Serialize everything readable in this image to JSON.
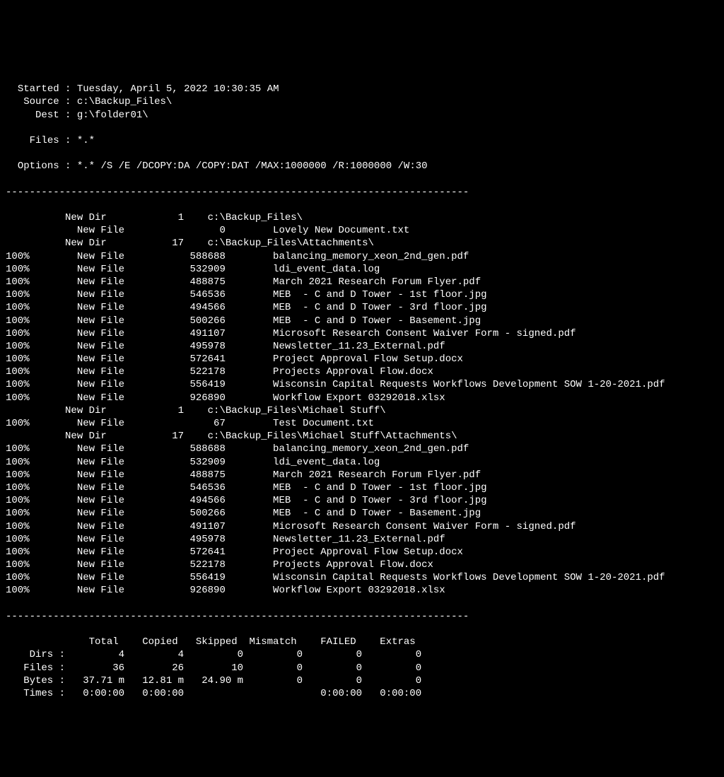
{
  "header": {
    "started_label": "Started",
    "started_value": "Tuesday, April 5, 2022 10:30:35 AM",
    "source_label": "Source",
    "source_value": "c:\\Backup_Files\\",
    "dest_label": "Dest",
    "dest_value": "g:\\folder01\\",
    "files_label": "Files",
    "files_value": "*.*",
    "options_label": "Options",
    "options_value": "*.* /S /E /DCOPY:DA /COPY:DAT /MAX:1000000 /R:1000000 /W:30"
  },
  "separator": "------------------------------------------------------------------------------",
  "rows": [
    {
      "pct": "",
      "status": "New Dir",
      "count": "1",
      "size": "",
      "path": "c:\\Backup_Files\\"
    },
    {
      "pct": "",
      "status": "New File",
      "count": "",
      "size": "0",
      "path": "Lovely New Document.txt"
    },
    {
      "pct": "",
      "status": "New Dir",
      "count": "17",
      "size": "",
      "path": "c:\\Backup_Files\\Attachments\\"
    },
    {
      "pct": "100%",
      "status": "New File",
      "count": "",
      "size": "588688",
      "path": "balancing_memory_xeon_2nd_gen.pdf"
    },
    {
      "pct": "100%",
      "status": "New File",
      "count": "",
      "size": "532909",
      "path": "ldi_event_data.log"
    },
    {
      "pct": "100%",
      "status": "New File",
      "count": "",
      "size": "488875",
      "path": "March 2021 Research Forum Flyer.pdf"
    },
    {
      "pct": "100%",
      "status": "New File",
      "count": "",
      "size": "546536",
      "path": "MEB  - C and D Tower - 1st floor.jpg"
    },
    {
      "pct": "100%",
      "status": "New File",
      "count": "",
      "size": "494566",
      "path": "MEB  - C and D Tower - 3rd floor.jpg"
    },
    {
      "pct": "100%",
      "status": "New File",
      "count": "",
      "size": "500266",
      "path": "MEB  - C and D Tower - Basement.jpg"
    },
    {
      "pct": "100%",
      "status": "New File",
      "count": "",
      "size": "491107",
      "path": "Microsoft Research Consent Waiver Form - signed.pdf"
    },
    {
      "pct": "100%",
      "status": "New File",
      "count": "",
      "size": "495978",
      "path": "Newsletter_11.23_External.pdf"
    },
    {
      "pct": "100%",
      "status": "New File",
      "count": "",
      "size": "572641",
      "path": "Project Approval Flow Setup.docx"
    },
    {
      "pct": "100%",
      "status": "New File",
      "count": "",
      "size": "522178",
      "path": "Projects Approval Flow.docx"
    },
    {
      "pct": "100%",
      "status": "New File",
      "count": "",
      "size": "556419",
      "path": "Wisconsin Capital Requests Workflows Development SOW 1-20-2021.pdf"
    },
    {
      "pct": "100%",
      "status": "New File",
      "count": "",
      "size": "926890",
      "path": "Workflow Export 03292018.xlsx"
    },
    {
      "pct": "",
      "status": "New Dir",
      "count": "1",
      "size": "",
      "path": "c:\\Backup_Files\\Michael Stuff\\"
    },
    {
      "pct": "100%",
      "status": "New File",
      "count": "",
      "size": "67",
      "path": "Test Document.txt"
    },
    {
      "pct": "",
      "status": "New Dir",
      "count": "17",
      "size": "",
      "path": "c:\\Backup_Files\\Michael Stuff\\Attachments\\"
    },
    {
      "pct": "100%",
      "status": "New File",
      "count": "",
      "size": "588688",
      "path": "balancing_memory_xeon_2nd_gen.pdf"
    },
    {
      "pct": "100%",
      "status": "New File",
      "count": "",
      "size": "532909",
      "path": "ldi_event_data.log"
    },
    {
      "pct": "100%",
      "status": "New File",
      "count": "",
      "size": "488875",
      "path": "March 2021 Research Forum Flyer.pdf"
    },
    {
      "pct": "100%",
      "status": "New File",
      "count": "",
      "size": "546536",
      "path": "MEB  - C and D Tower - 1st floor.jpg"
    },
    {
      "pct": "100%",
      "status": "New File",
      "count": "",
      "size": "494566",
      "path": "MEB  - C and D Tower - 3rd floor.jpg"
    },
    {
      "pct": "100%",
      "status": "New File",
      "count": "",
      "size": "500266",
      "path": "MEB  - C and D Tower - Basement.jpg"
    },
    {
      "pct": "100%",
      "status": "New File",
      "count": "",
      "size": "491107",
      "path": "Microsoft Research Consent Waiver Form - signed.pdf"
    },
    {
      "pct": "100%",
      "status": "New File",
      "count": "",
      "size": "495978",
      "path": "Newsletter_11.23_External.pdf"
    },
    {
      "pct": "100%",
      "status": "New File",
      "count": "",
      "size": "572641",
      "path": "Project Approval Flow Setup.docx"
    },
    {
      "pct": "100%",
      "status": "New File",
      "count": "",
      "size": "522178",
      "path": "Projects Approval Flow.docx"
    },
    {
      "pct": "100%",
      "status": "New File",
      "count": "",
      "size": "556419",
      "path": "Wisconsin Capital Requests Workflows Development SOW 1-20-2021.pdf"
    },
    {
      "pct": "100%",
      "status": "New File",
      "count": "",
      "size": "926890",
      "path": "Workflow Export 03292018.xlsx"
    }
  ],
  "summary": {
    "headers": [
      "Total",
      "Copied",
      "Skipped",
      "Mismatch",
      "FAILED",
      "Extras"
    ],
    "rows": [
      {
        "label": "Dirs",
        "values": [
          "4",
          "4",
          "0",
          "0",
          "0",
          "0"
        ]
      },
      {
        "label": "Files",
        "values": [
          "36",
          "26",
          "10",
          "0",
          "0",
          "0"
        ]
      },
      {
        "label": "Bytes",
        "values": [
          "37.71 m",
          "12.81 m",
          "24.90 m",
          "0",
          "0",
          "0"
        ]
      },
      {
        "label": "Times",
        "values": [
          "0:00:00",
          "0:00:00",
          "",
          "",
          "0:00:00",
          "0:00:00"
        ]
      }
    ]
  }
}
